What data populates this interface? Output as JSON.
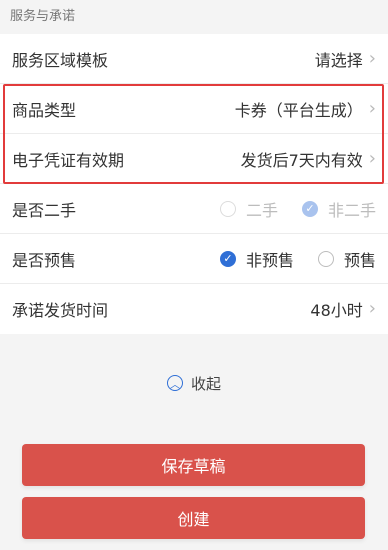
{
  "section": {
    "title": "服务与承诺"
  },
  "rows": {
    "service_area": {
      "label": "服务区域模板",
      "value": "请选择"
    },
    "product_type": {
      "label": "商品类型",
      "value": "卡券（平台生成）"
    },
    "voucher_validity": {
      "label": "电子凭证有效期",
      "value": "发货后7天内有效"
    },
    "second_hand": {
      "label": "是否二手",
      "option_yes": "二手",
      "option_no": "非二手",
      "selected": "非二手",
      "disabled": true
    },
    "presale": {
      "label": "是否预售",
      "option_no": "非预售",
      "option_yes": "预售",
      "selected": "非预售"
    },
    "shipping_time": {
      "label": "承诺发货时间",
      "value": "48小时"
    }
  },
  "collapse": {
    "label": "收起",
    "icon": "chevron-up-circle-icon"
  },
  "buttons": {
    "save_draft": "保存草稿",
    "create": "创建"
  },
  "colors": {
    "accent": "#2f6fd6",
    "button": "#d9524b",
    "highlight": "#e23b3b"
  }
}
